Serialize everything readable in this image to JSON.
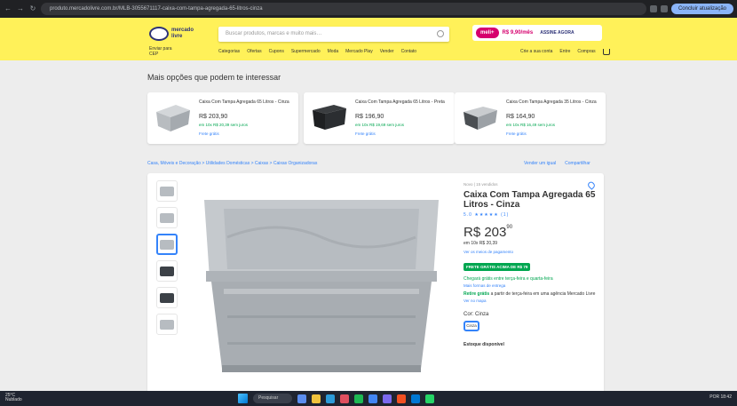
{
  "browser": {
    "url": "produto.mercadolivre.com.br/MLB-3055671117-caixa-com-tampa-agregada-65-litros-cinza",
    "update_label": "Concluir atualização"
  },
  "header": {
    "logo_line1": "mercado",
    "logo_line2": "livre",
    "search_placeholder": "Buscar produtos, marcas e muito mais…",
    "promo_badge": "meli+",
    "promo_price": "R$ 9,90/mês",
    "promo_cta": "ASSINE AGORA",
    "cep_line1": "Enviar para",
    "cep_line2": "CEP",
    "nav": [
      "Categorias",
      "Ofertas",
      "Cupons",
      "Supermercado",
      "Moda",
      "Mercado Play",
      "Vender",
      "Contato"
    ],
    "user": [
      "Crie a sua conta",
      "Entre",
      "Compras"
    ]
  },
  "related": {
    "title": "Mais opções que podem te interessar",
    "items": [
      {
        "title": "Caixa Com Tampa Agregada 65 Litros - Cinza",
        "price": "R$ 203,90",
        "installments": "em 10x R$ 20,39 sem juros",
        "link": "Frete grátis"
      },
      {
        "title": "Caixa Com Tampa Agregada 65 Litros - Preta",
        "price": "R$ 196,90",
        "installments": "em 10x R$ 19,69 sem juros",
        "link": "Frete grátis"
      },
      {
        "title": "Caixa Com Tampa Agregada 35 Litros - Cinza",
        "price": "R$ 164,90",
        "installments": "em 10x R$ 16,49 sem juros",
        "link": "Frete grátis"
      }
    ]
  },
  "breadcrumb": "Casa, Móveis e Decoração > Utilidades Domésticas > Caixas > Caixas Organizadoras",
  "share": [
    "Vender um igual",
    "Compartilhar"
  ],
  "product": {
    "condition": "Novo  |  15 vendidos",
    "title": "Caixa Com Tampa Agregada 65 Litros - Cinza",
    "rating": "5.0 ★★★★★ (1)",
    "price_int": "R$ 203",
    "price_cents": "90",
    "installments": "em 10x R$ 20,39",
    "payments": "Ver os meios de pagamento",
    "shipping_badge": "FRETE GRÁTIS ACIMA DE R$ 79",
    "free_shipping": "Chegará grátis entre terça-feira e quarta-feira",
    "free_shipping_link": "Mais formas de entrega",
    "pickup": "Retire grátis",
    "pickup_rest": " a partir de terça-feira em uma agência Mercado Livre",
    "pickup_link": "Ver no mapa",
    "color_label": "Cor: Cinza",
    "color_chip": "Cinza",
    "stock": "Estoque disponível"
  },
  "taskbar": {
    "weather_temp": "25°C",
    "weather_desc": "Nublado",
    "search_label": "Pesquisar",
    "tray": "POR  18:42"
  }
}
